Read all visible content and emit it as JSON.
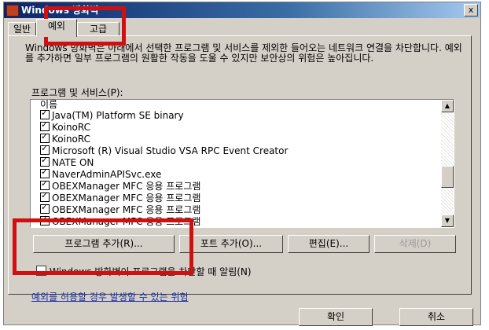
{
  "window": {
    "title": "Windows 방화벽",
    "close_label": "x"
  },
  "tabs": [
    {
      "label": "일반"
    },
    {
      "label": "예외"
    },
    {
      "label": "고급"
    }
  ],
  "description": "Windows 방화벽은 아래에서 선택한 프로그램 및 서비스를 제외한 들어오는 네트워크 연결을 차단합니다. 예외를 추가하면 일부 프로그램의 원활한 작동을 도울 수 있지만 보안상의 위험은 높아집니다.",
  "programs": {
    "label": "프로그램 및 서비스(P):",
    "column_header": "이름",
    "items": [
      {
        "name": "Java(TM) Platform SE binary"
      },
      {
        "name": "KoinoRC"
      },
      {
        "name": "KoinoRC"
      },
      {
        "name": "Microsoft (R) Visual Studio VSA RPC Event Creator"
      },
      {
        "name": "NATE ON"
      },
      {
        "name": "NaverAdminAPISvc.exe"
      },
      {
        "name": "OBEXManager MFC 응용 프로그램"
      },
      {
        "name": "OBEXManager MFC 응용 프로그램"
      },
      {
        "name": "OBEXManager MFC 응용 프로그램"
      },
      {
        "name": "OBEXManager MFC 응용 프로그램"
      }
    ]
  },
  "buttons": {
    "add_program": "프로그램 추가(R)...",
    "add_port": "포트 추가(O)...",
    "edit": "편집(E)...",
    "delete": "삭제(D)",
    "ok": "확인",
    "cancel": "취소"
  },
  "notify_checkbox": "Windows 방화벽이 프로그램을 차단할 때 알림(N)",
  "risk_link": "예외를 허용할 경우 발생할 수 있는 위험"
}
